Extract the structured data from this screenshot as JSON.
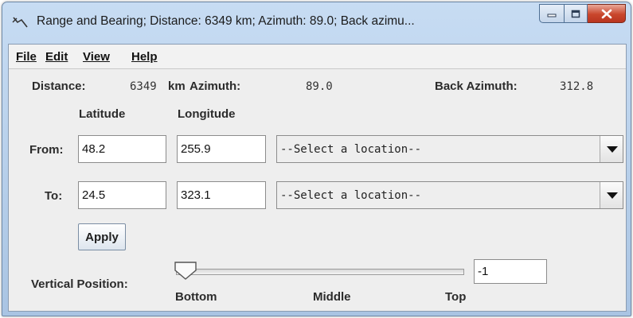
{
  "window": {
    "title": "Range and Bearing; Distance: 6349 km; Azimuth: 89.0; Back azimu...",
    "icons": [
      "range-bearing-icon",
      "minimize-icon",
      "maximize-icon",
      "close-icon"
    ]
  },
  "menu": [
    "File",
    "Edit",
    "View",
    "Help"
  ],
  "summary": {
    "distance_label": "Distance:",
    "distance_value": "6349",
    "distance_unit": "km",
    "azimuth_label": "Azimuth:",
    "azimuth_value": "89.0",
    "back_azimuth_label": "Back Azimuth:",
    "back_azimuth_value": "312.8"
  },
  "columns": {
    "latitude": "Latitude",
    "longitude": "Longitude"
  },
  "rows": [
    {
      "label": "From:",
      "latitude": "48.2",
      "longitude": "255.9",
      "location": "--Select a location--"
    },
    {
      "label": "To:",
      "latitude": "24.5",
      "longitude": "323.1",
      "location": "--Select a location--"
    }
  ],
  "apply_label": "Apply",
  "vertical": {
    "label": "Vertical Position:",
    "ticks": [
      "Bottom",
      "Middle",
      "Top"
    ],
    "value": "-1",
    "slider_position": 0
  },
  "colors": {
    "title_bar": "#c7dcf3",
    "close_button": "#c9462c",
    "panel": "#eeeeee"
  }
}
